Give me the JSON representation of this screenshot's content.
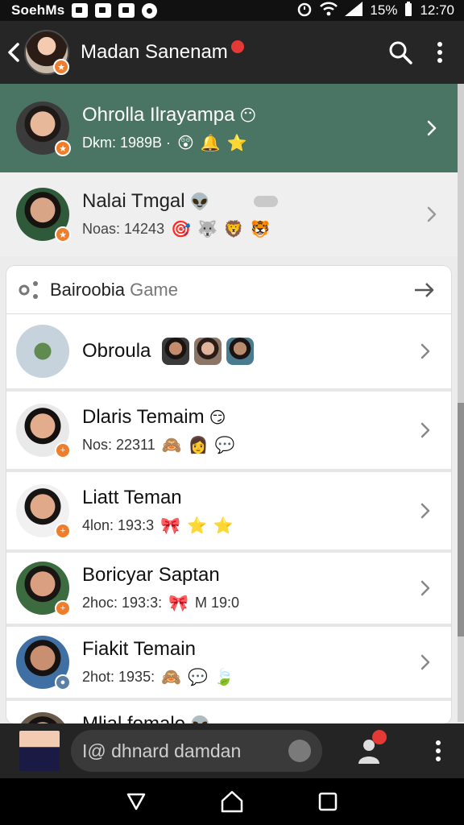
{
  "status_bar": {
    "carrier": "SoehMs",
    "battery": "15%",
    "time": "12:70"
  },
  "header": {
    "title": "Madan Sanenam"
  },
  "top_rows": [
    {
      "name": "Ohrolla Ilrayampa",
      "name_emoji": "😶",
      "sub": "Dkm: 1989B ·",
      "emojis": [
        "😲",
        "🔔",
        "⭐"
      ]
    },
    {
      "name": "Nalai Tmgal",
      "name_emoji": "👽",
      "sub": "Noas: 14243",
      "emojis": [
        "🎯",
        "🐺",
        "🦁",
        "🐯"
      ]
    }
  ],
  "card": {
    "title": "Bairoobia",
    "title_muted": "Game"
  },
  "items": [
    {
      "name": "Obroula",
      "sub": ""
    },
    {
      "name": "Dlaris Temaim",
      "name_emoji": "😏",
      "sub": "Nos: 22311",
      "emojis": [
        "🙈",
        "👩",
        "💬"
      ]
    },
    {
      "name": "Liatt Teman",
      "sub": "4lon: 193:3",
      "emojis": [
        "🎀",
        "⭐",
        "⭐"
      ]
    },
    {
      "name": "Boricyar Saptan",
      "sub": "2hoc: 193:3:",
      "emojis": [
        "🎀"
      ],
      "sub_extra": "M 19:0"
    },
    {
      "name": "Fiakit Temain",
      "sub": "2hot: 1935:",
      "emojis": [
        "🙈",
        "💬",
        "🍃"
      ]
    },
    {
      "name": "Mlial fomale",
      "name_emoji": "👽",
      "sub": ""
    }
  ],
  "composer": {
    "placeholder": "I@ dhnard damdan"
  }
}
